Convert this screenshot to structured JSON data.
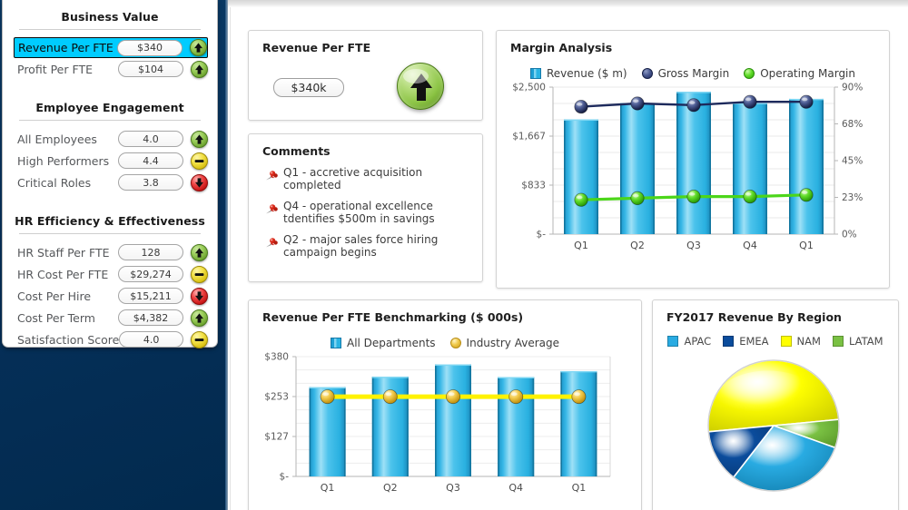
{
  "colors": {
    "navy_panel": "#032A52",
    "selected_row": "#00CCFF",
    "bar_blue": "#29B3E3",
    "bar_blue_dark": "#1D9FD4",
    "gross_margin_navy": "#1D2A5C",
    "operating_margin_green": "#4CD61A",
    "industry_average_yellow": "#FFF200",
    "apac": "#29ABE2",
    "emea": "#0B4C9C",
    "nam": "#FFFF00",
    "latam": "#7AC143",
    "indicator_up": "#8CC445",
    "indicator_flat": "#F3E24A",
    "indicator_down": "#EF4545"
  },
  "sidebar": {
    "groups": [
      {
        "title": "Business Value",
        "rows": [
          {
            "label": "Revenue Per FTE",
            "value": "$340",
            "indicator": "up",
            "selected": true
          },
          {
            "label": "Profit Per FTE",
            "value": "$104",
            "indicator": "up",
            "selected": false
          }
        ]
      },
      {
        "title": "Employee Engagement",
        "rows": [
          {
            "label": "All Employees",
            "value": "4.0",
            "indicator": "up",
            "selected": false
          },
          {
            "label": "High Performers",
            "value": "4.4",
            "indicator": "flat",
            "selected": false
          },
          {
            "label": "Critical Roles",
            "value": "3.8",
            "indicator": "down",
            "selected": false
          }
        ]
      },
      {
        "title": "HR Efficiency & Effectiveness",
        "rows": [
          {
            "label": "HR Staff Per FTE",
            "value": "128",
            "indicator": "up",
            "selected": false
          },
          {
            "label": "HR Cost Per FTE",
            "value": "$29,274",
            "indicator": "flat",
            "selected": false
          },
          {
            "label": "Cost Per Hire",
            "value": "$15,211",
            "indicator": "down",
            "selected": false
          },
          {
            "label": "Cost Per Term",
            "value": "$4,382",
            "indicator": "up",
            "selected": false
          },
          {
            "label": "Satisfaction Score",
            "value": "4.0",
            "indicator": "flat",
            "selected": false
          }
        ]
      }
    ]
  },
  "revenue_card": {
    "title": "Revenue Per FTE",
    "value": "$340k",
    "trend_icon": "arrow-up-icon",
    "trend": "up"
  },
  "comments_card": {
    "title": "Comments",
    "icon": "pushpin-icon",
    "items": [
      "Q1 - accretive acquisition completed",
      "Q4 - operational excellence tdentifies $500m in savings",
      "Q2 - major sales force hiring campaign begins"
    ]
  },
  "chart_data": [
    {
      "id": "margin-analysis",
      "type": "bar",
      "title": "Margin Analysis",
      "xlabel": "",
      "ylabel": "",
      "grid": true,
      "legend_position": "top",
      "categories": [
        "Q1",
        "Q2",
        "Q3",
        "Q4",
        "Q1"
      ],
      "left_axis": {
        "ticks": [
          "$-",
          "$833",
          "$1,667",
          "$2,500"
        ],
        "ylim": [
          0,
          2500
        ]
      },
      "right_axis": {
        "ticks": [
          "0%",
          "23%",
          "45%",
          "68%",
          "90%"
        ],
        "ylim": [
          0,
          90
        ]
      },
      "series": [
        {
          "name": "Revenue ($ m)",
          "kind": "bar",
          "axis": "left",
          "values": [
            1950,
            2230,
            2420,
            2230,
            2300
          ]
        },
        {
          "name": "Gross Margin",
          "kind": "line",
          "axis": "right",
          "values": [
            78,
            80,
            79,
            81,
            81
          ]
        },
        {
          "name": "Operating Margin",
          "kind": "line",
          "axis": "right",
          "values": [
            21,
            22,
            23,
            23,
            24
          ]
        }
      ]
    },
    {
      "id": "revenue-per-fte-benchmarking",
      "type": "bar",
      "title": "Revenue Per FTE Benchmarking ($ 000s)",
      "xlabel": "",
      "ylabel": "",
      "grid": true,
      "legend_position": "top",
      "categories": [
        "Q1",
        "Q2",
        "Q3",
        "Q4",
        "Q1"
      ],
      "left_axis": {
        "ticks": [
          "$-",
          "$127",
          "$253",
          "$380"
        ],
        "ylim": [
          0,
          380
        ]
      },
      "series": [
        {
          "name": "All Departments",
          "kind": "bar",
          "values": [
            283,
            316,
            355,
            315,
            334
          ]
        },
        {
          "name": "Industry Average",
          "kind": "line",
          "values": [
            253,
            253,
            253,
            253,
            253
          ]
        }
      ]
    },
    {
      "id": "fy2017-revenue-by-region",
      "type": "pie",
      "title": "FY2017 Revenue By Region",
      "legend_position": "top",
      "labels": [
        "APAC",
        "EMEA",
        "NAM",
        "LATAM"
      ],
      "values": [
        30,
        13,
        50,
        7
      ]
    }
  ]
}
